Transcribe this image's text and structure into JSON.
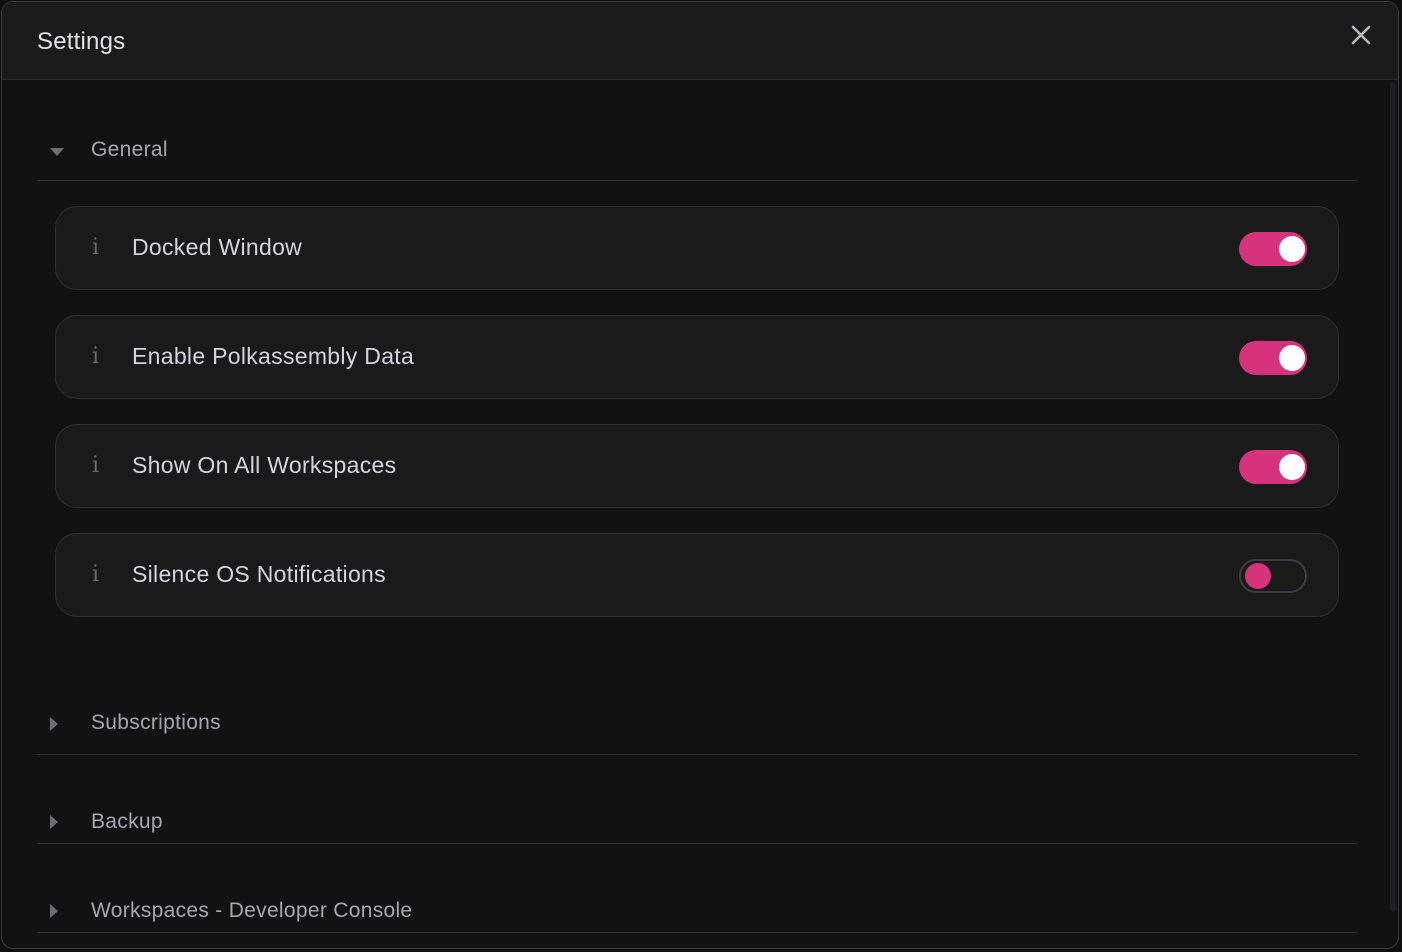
{
  "window": {
    "title": "Settings",
    "close_icon": "close-icon"
  },
  "sections": {
    "general": {
      "label": "General",
      "expanded": true,
      "settings": [
        {
          "label": "Docked Window",
          "enabled": true
        },
        {
          "label": "Enable Polkassembly Data",
          "enabled": true
        },
        {
          "label": "Show On All Workspaces",
          "enabled": true
        },
        {
          "label": "Silence OS Notifications",
          "enabled": false
        }
      ]
    },
    "subscriptions": {
      "label": "Subscriptions",
      "expanded": false
    },
    "backup": {
      "label": "Backup",
      "expanded": false
    },
    "workspaces": {
      "label": "Workspaces - Developer Console",
      "expanded": false
    }
  },
  "icons": {
    "info": "info-icon",
    "expanded_arrow": "caret-down-icon",
    "collapsed_arrow": "caret-right-icon"
  },
  "colors": {
    "accent": "#d6337c",
    "background": "#121213",
    "row_background": "#1a1a1b"
  }
}
